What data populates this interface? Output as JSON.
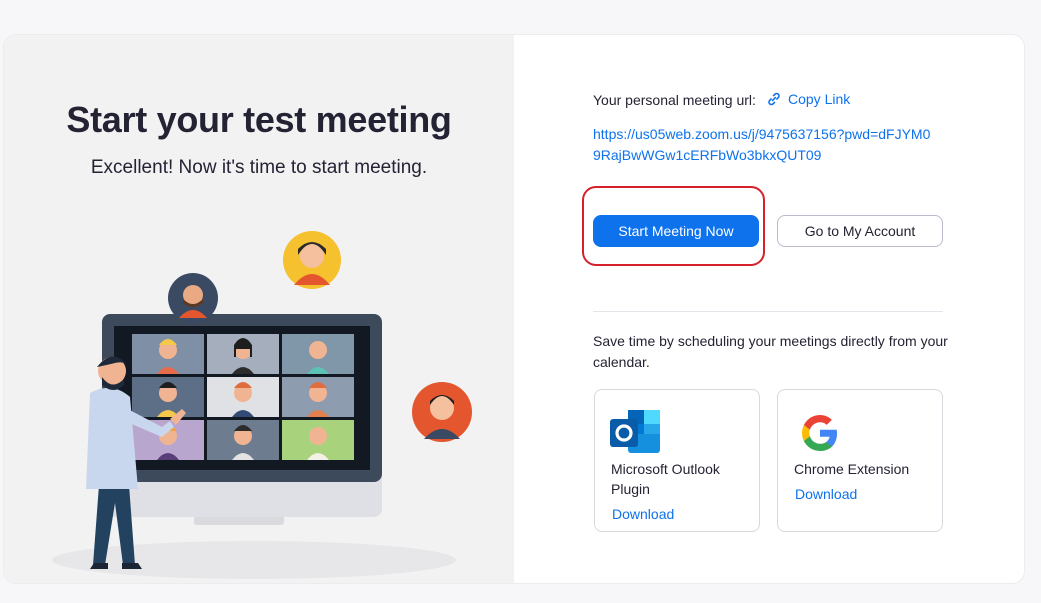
{
  "hero": {
    "title": "Start your test meeting",
    "subtitle": "Excellent! Now it's time to start meeting."
  },
  "meeting": {
    "url_label": "Your personal meeting url:",
    "copy_link_label": "Copy Link",
    "url": "https://us05web.zoom.us/j/9475637156?pwd=dFJYM09RajBwWGw1cERFbWo3bkxQUT09"
  },
  "actions": {
    "start_meeting_label": "Start Meeting Now",
    "go_to_account_label": "Go to My Account"
  },
  "schedule": {
    "text": "Save time by scheduling your meetings directly from your calendar."
  },
  "plugins": [
    {
      "name": "Microsoft Outlook Plugin",
      "download_label": "Download",
      "icon": "outlook-icon"
    },
    {
      "name": "Chrome Extension",
      "download_label": "Download",
      "icon": "google-icon"
    }
  ],
  "colors": {
    "accent": "#0e72ed",
    "highlight": "#d6212b",
    "text": "#232333",
    "left_panel_bg": "#f2f2f3"
  }
}
